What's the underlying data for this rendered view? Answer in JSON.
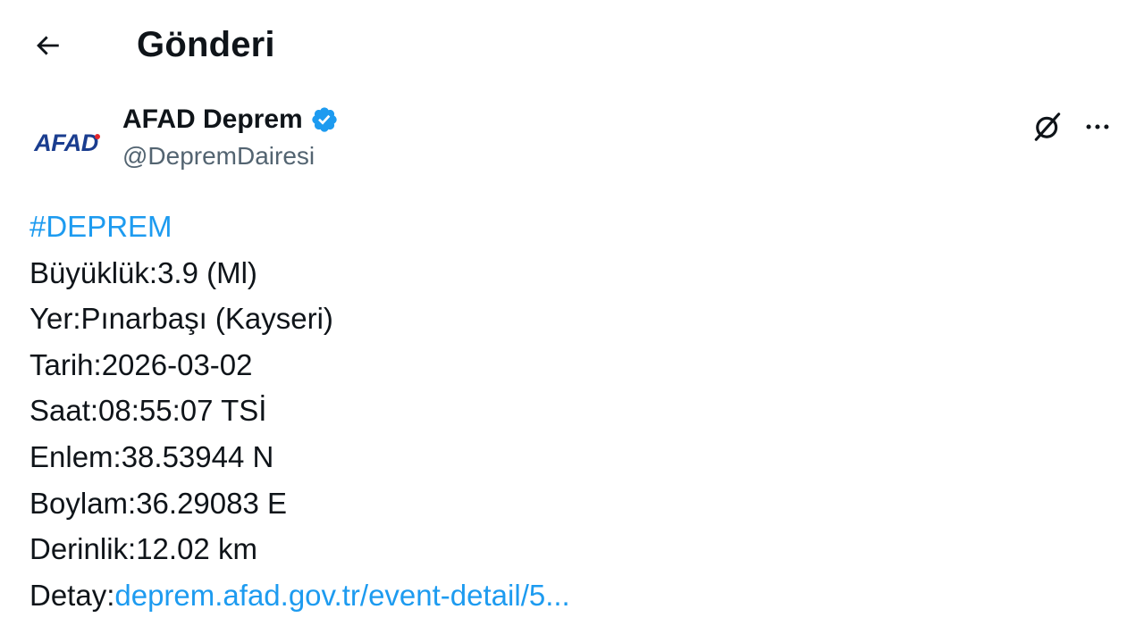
{
  "header": {
    "back_icon": "arrow-left-icon",
    "title": "Gönderi"
  },
  "author": {
    "avatar_text": "AFAD",
    "display_name": "AFAD Deprem",
    "verified_icon": "verified-badge-icon",
    "handle": "@DepremDairesi"
  },
  "actions": {
    "grok_icon": "grok-icon",
    "more_icon": "more-horizontal-icon"
  },
  "post": {
    "hashtag": "#DEPREM",
    "lines": [
      "Büyüklük:3.9 (Ml)",
      "Yer:Pınarbaşı (Kayseri)",
      "Tarih:2026-03-02",
      "Saat:08:55:07 TSİ",
      "Enlem:38.53944 N",
      "Boylam:36.29083 E",
      "Derinlik:12.02 km"
    ],
    "detail_label": "Detay:",
    "detail_link": "deprem.afad.gov.tr/event-detail/5..."
  },
  "colors": {
    "accent": "#1d9bf0",
    "text": "#0f1419",
    "secondary": "#536471",
    "afad_blue": "#1a3d8f",
    "afad_red": "#e3262b"
  }
}
